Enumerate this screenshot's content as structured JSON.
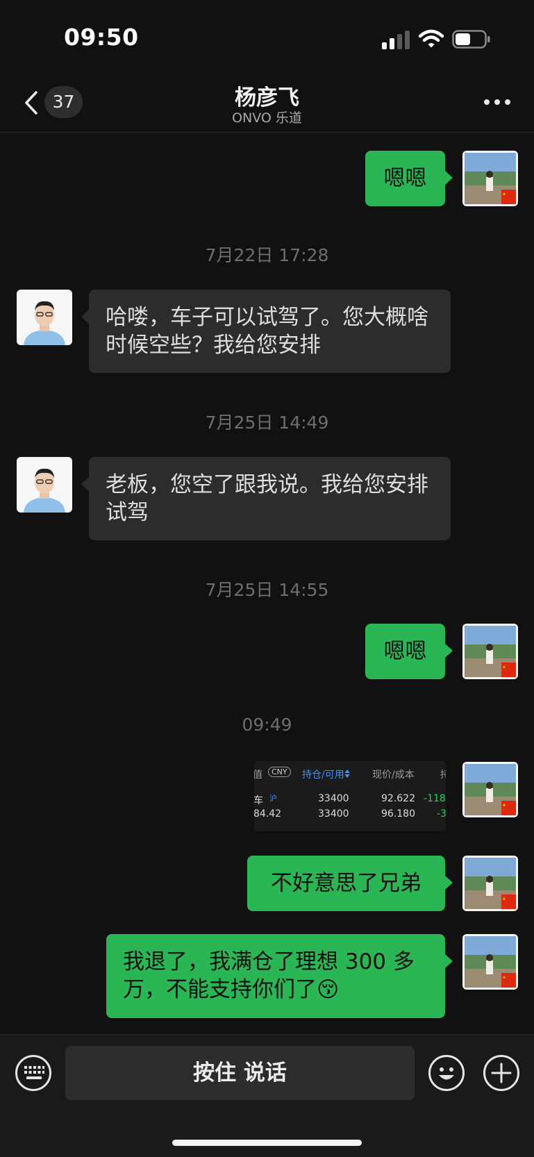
{
  "status_bar": {
    "time": "09:50"
  },
  "header": {
    "unread_count": "37",
    "contact_name": "杨彦飞",
    "contact_subtitle": "ONVO 乐道"
  },
  "messages": [
    {
      "type": "text",
      "sender": "me",
      "text": "嗯嗯"
    },
    {
      "type": "timestamp",
      "text": "7月22日 17:28"
    },
    {
      "type": "text",
      "sender": "contact",
      "text": "哈喽，车子可以试驾了。您大概啥时候空些？我给您安排"
    },
    {
      "type": "timestamp",
      "text": "7月25日 14:49"
    },
    {
      "type": "text",
      "sender": "contact",
      "text": "老板，您空了跟我说。我给您安排试驾"
    },
    {
      "type": "timestamp",
      "text": "7月25日 14:55"
    },
    {
      "type": "text",
      "sender": "me",
      "text": "嗯嗯"
    },
    {
      "type": "timestamp",
      "text": "09:49"
    },
    {
      "type": "image",
      "sender": "me",
      "content": {
        "head_prefix": "值",
        "currency": "CNY",
        "head_position": "持仓/可用",
        "head_price": "现价/成本",
        "head_cut": "持",
        "row1_name": "车",
        "row1_market": "沪",
        "row1_qty": "33400",
        "row1_price": "92.622",
        "row1_pl": "-118",
        "row2_val": "84.42",
        "row2_qty": "33400",
        "row2_cost": "96.180",
        "row2_pl": "-3"
      }
    },
    {
      "type": "text",
      "sender": "me",
      "text": "不好意思了兄弟"
    },
    {
      "type": "text",
      "sender": "me",
      "text": "我退了，我满仓了理想 300 多万，不能支持你们了😚"
    }
  ],
  "input_bar": {
    "hold_to_talk_label": "按住 说话"
  },
  "icons": [
    "back-chevron-icon",
    "more-icon",
    "keyboard-icon",
    "emoji-icon",
    "plus-icon",
    "signal-icon",
    "wifi-icon",
    "battery-icon"
  ],
  "colors": {
    "background": "#111111",
    "sent_bubble": "#2bb656",
    "received_bubble": "#2c2c2c",
    "timestamp": "#6e6e6e"
  }
}
